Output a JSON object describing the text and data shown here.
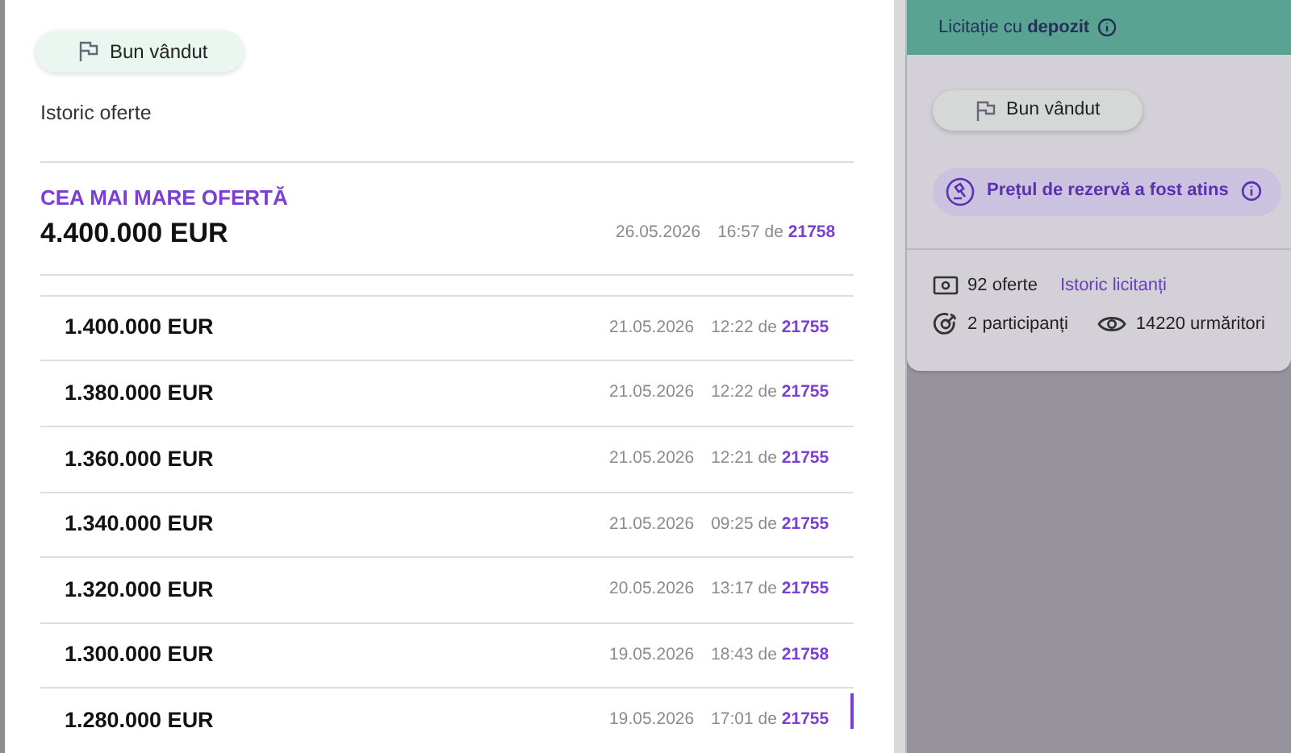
{
  "offers_panel": {
    "sold_button": "Bun vândut",
    "history_title": "Istoric oferte",
    "highest": {
      "label": "CEA MAI MARE OFERTĂ",
      "amount": "4.400.000 EUR",
      "date": "26.05.2026",
      "time": "16:57",
      "by": "de",
      "bidder": "21758"
    },
    "rows": [
      {
        "amount": "1.400.000 EUR",
        "date": "21.05.2026",
        "time": "12:22",
        "by": "de",
        "bidder": "21755"
      },
      {
        "amount": "1.380.000 EUR",
        "date": "21.05.2026",
        "time": "12:22",
        "by": "de",
        "bidder": "21755"
      },
      {
        "amount": "1.360.000 EUR",
        "date": "21.05.2026",
        "time": "12:21",
        "by": "de",
        "bidder": "21755"
      },
      {
        "amount": "1.340.000 EUR",
        "date": "21.05.2026",
        "time": "09:25",
        "by": "de",
        "bidder": "21755"
      },
      {
        "amount": "1.320.000 EUR",
        "date": "20.05.2026",
        "time": "13:17",
        "by": "de",
        "bidder": "21755"
      },
      {
        "amount": "1.300.000 EUR",
        "date": "19.05.2026",
        "time": "18:43",
        "by": "de",
        "bidder": "21758"
      },
      {
        "amount": "1.280.000 EUR",
        "date": "19.05.2026",
        "time": "17:01",
        "by": "de",
        "bidder": "21755"
      }
    ]
  },
  "auction_panel": {
    "header": "Licitație cu **depozit**",
    "sold_button": "Bun vândut",
    "reserve_notice": "Prețul de rezervă a fost atins",
    "offers_count": "92 oferte",
    "bidders_link": "Istoric licitanți",
    "participants": "2 participanți",
    "watchers": "14220 urmăritori"
  }
}
